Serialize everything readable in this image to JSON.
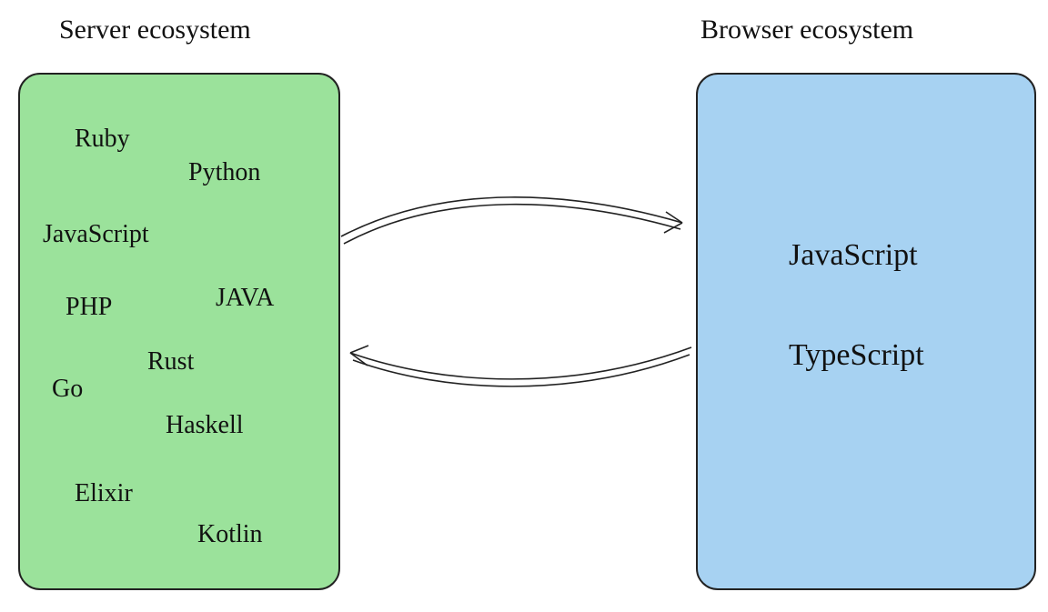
{
  "server": {
    "title": "Server ecosystem",
    "languages": {
      "ruby": "Ruby",
      "python": "Python",
      "javascript": "JavaScript",
      "java": "JAVA",
      "php": "PHP",
      "rust": "Rust",
      "go": "Go",
      "haskell": "Haskell",
      "elixir": "Elixir",
      "kotlin": "Kotlin"
    }
  },
  "browser": {
    "title": "Browser ecosystem",
    "languages": {
      "javascript": "JavaScript",
      "typescript": "TypeScript"
    }
  }
}
